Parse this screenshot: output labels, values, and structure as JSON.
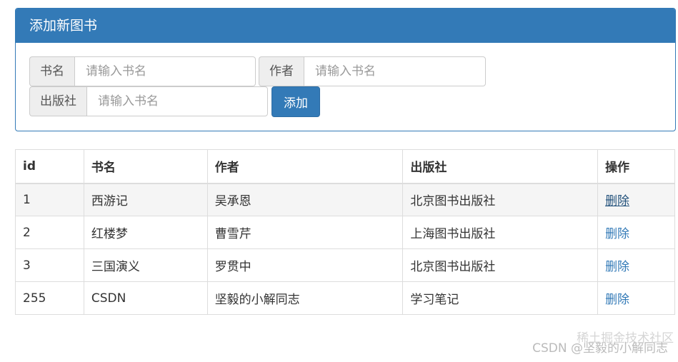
{
  "panel": {
    "title": "添加新图书",
    "fields": [
      {
        "label": "书名",
        "placeholder": "请输入书名",
        "value": ""
      },
      {
        "label": "作者",
        "placeholder": "请输入书名",
        "value": ""
      },
      {
        "label": "出版社",
        "placeholder": "请输入书名",
        "value": ""
      }
    ],
    "add_label": "添加"
  },
  "table": {
    "headers": [
      "id",
      "书名",
      "作者",
      "出版社",
      "操作"
    ],
    "rows": [
      {
        "id": "1",
        "name": "西游记",
        "author": "吴承恩",
        "publisher": "北京图书出版社",
        "action": "删除"
      },
      {
        "id": "2",
        "name": "红楼梦",
        "author": "曹雪芹",
        "publisher": "上海图书出版社",
        "action": "删除"
      },
      {
        "id": "3",
        "name": "三国演义",
        "author": "罗贯中",
        "publisher": "北京图书出版社",
        "action": "删除"
      },
      {
        "id": "255",
        "name": "CSDN",
        "author": "坚毅的小解同志",
        "publisher": "学习笔记",
        "action": "删除"
      }
    ]
  },
  "watermark": {
    "text": "CSDN @坚毅的小解同志",
    "overlay": "稀土掘金技术社区"
  },
  "colors": {
    "primary": "#337ab7",
    "border": "#dddddd",
    "stripe": "#f5f5f5"
  }
}
